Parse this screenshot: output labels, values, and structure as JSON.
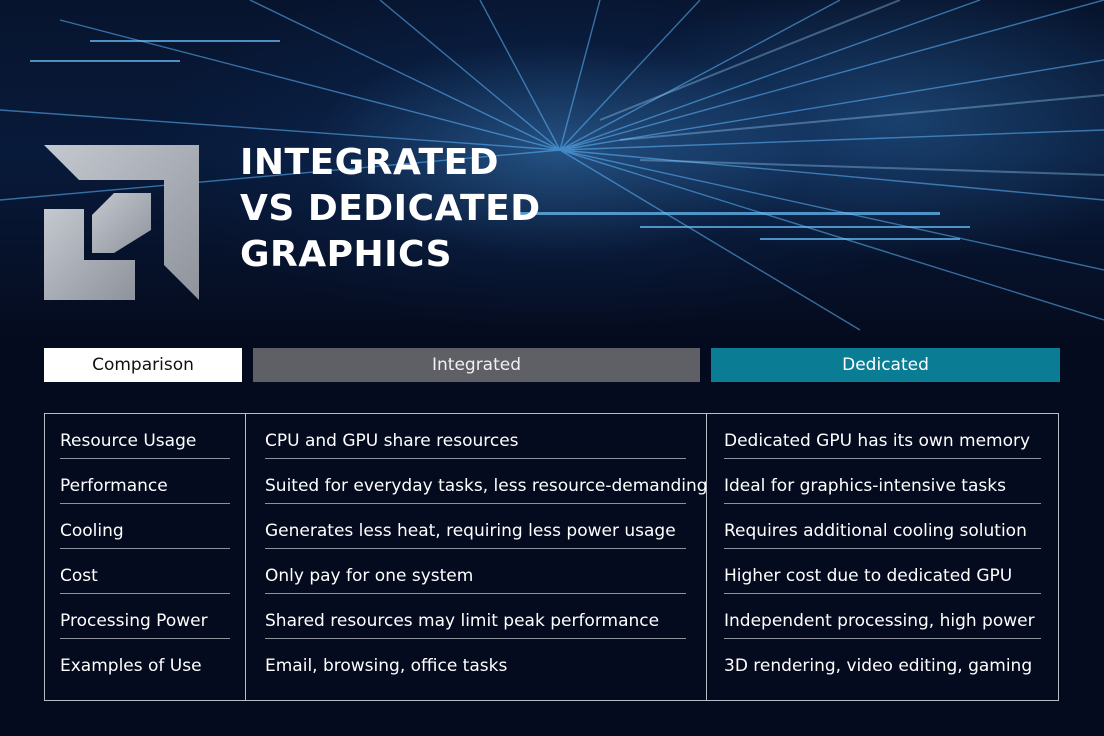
{
  "title_lines": [
    "INTEGRATED",
    "VS DEDICATED",
    "GRAPHICS"
  ],
  "headers": {
    "comparison": "Comparison",
    "integrated": "Integrated",
    "dedicated": "Dedicated"
  },
  "rows": [
    {
      "label": "Resource Usage",
      "integrated": "CPU and GPU share resources",
      "dedicated": "Dedicated GPU has its own memory"
    },
    {
      "label": "Performance",
      "integrated": "Suited for everyday tasks, less resource-demanding",
      "dedicated": "Ideal for graphics-intensive tasks"
    },
    {
      "label": "Cooling",
      "integrated": "Generates less heat, requiring less power usage",
      "dedicated": "Requires additional cooling solution"
    },
    {
      "label": "Cost",
      "integrated": "Only pay for one system",
      "dedicated": "Higher cost due to dedicated GPU"
    },
    {
      "label": "Processing Power",
      "integrated": "Shared resources may limit peak performance",
      "dedicated": "Independent processing, high power"
    },
    {
      "label": "Examples of Use",
      "integrated": "Email, browsing, office tasks",
      "dedicated": "3D rendering, video editing, gaming"
    }
  ],
  "colors": {
    "background": "#050b1e",
    "integrated_header": "#5e6066",
    "dedicated_header": "#0a7c93",
    "comparison_header": "#ffffff"
  }
}
